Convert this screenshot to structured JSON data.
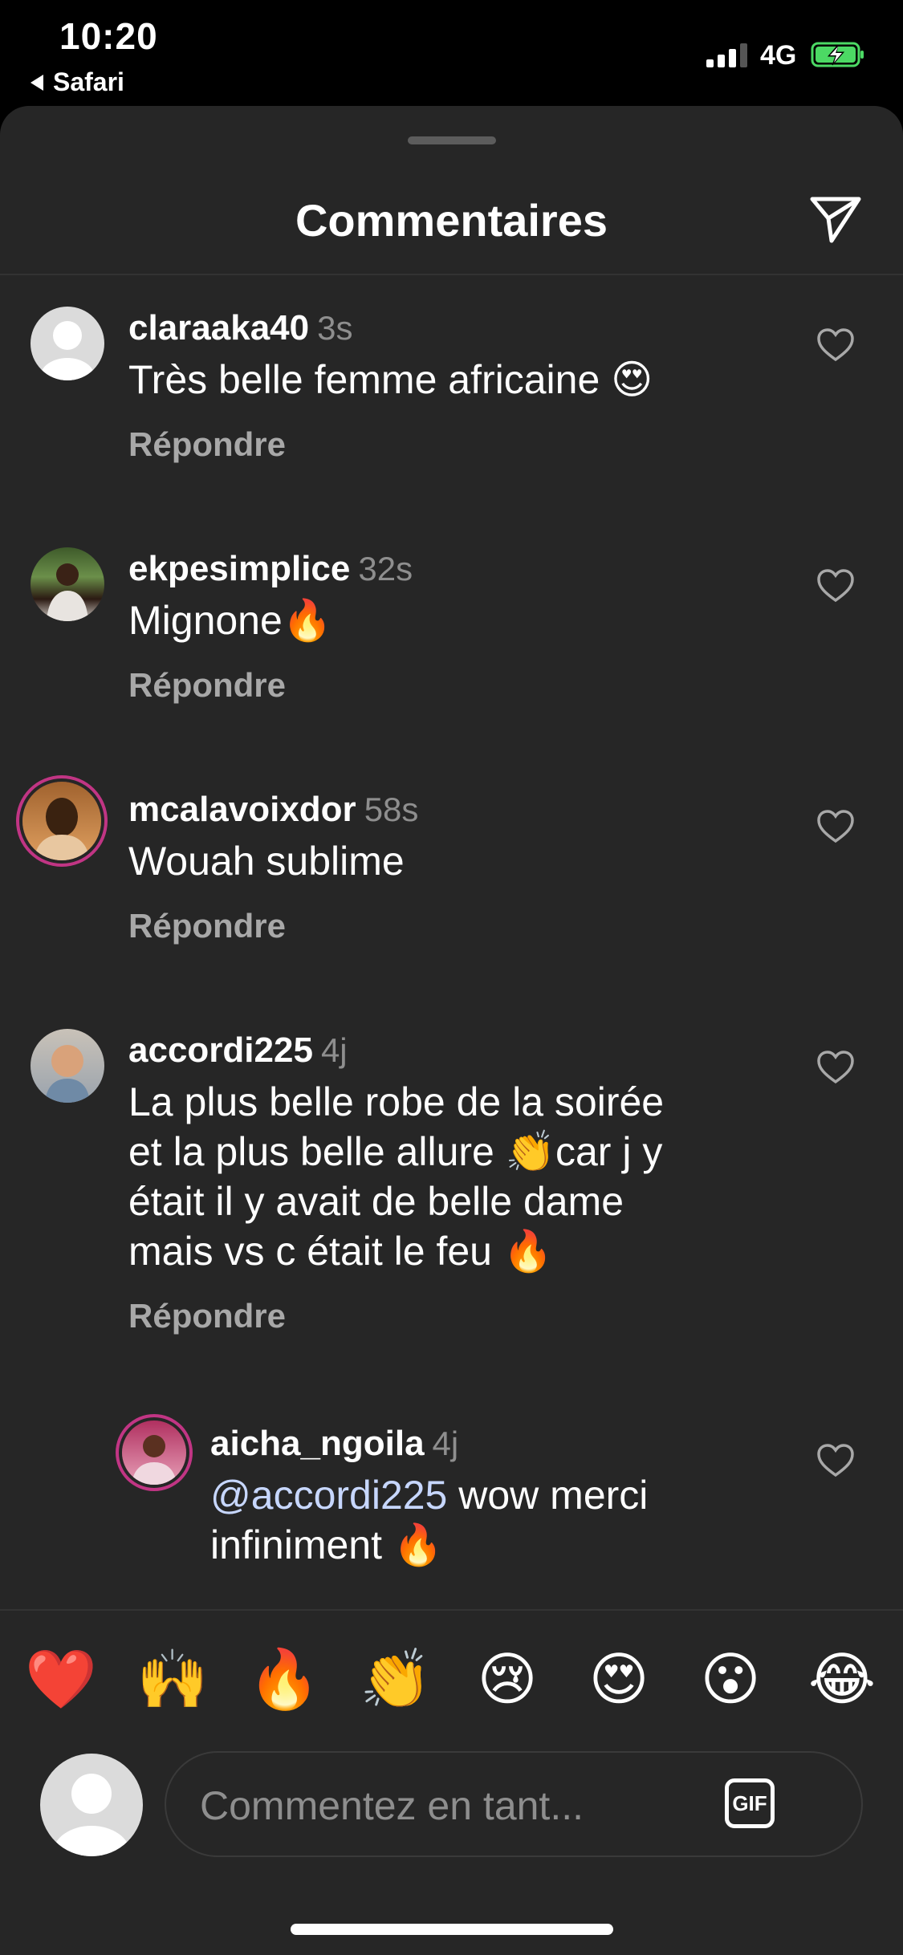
{
  "status_bar": {
    "time": "10:20",
    "back_label": "Safari",
    "network": "4G"
  },
  "sheet": {
    "title": "Commentaires"
  },
  "comments": [
    {
      "username": "claraaka40",
      "time": "3s",
      "text": "Très belle femme africaine 😍",
      "reply_label": "Répondre"
    },
    {
      "username": "ekpesimplice",
      "time": "32s",
      "text": "Mignone🔥",
      "reply_label": "Répondre"
    },
    {
      "username": "mcalavoixdor",
      "time": "58s",
      "text": "Wouah sublime",
      "reply_label": "Répondre"
    },
    {
      "username": "accordi225",
      "time": "4j",
      "text_lines": [
        "La plus belle robe de la soirée",
        "et la plus belle allure 👏car j y",
        "était il y avait de belle dame",
        "mais vs c était le feu 🔥"
      ],
      "reply_label": "Répondre"
    },
    {
      "username": "aicha_ngoila",
      "time": "4j",
      "mention": "@accordi225",
      "text_after_mention": " wow merci",
      "text_line2": "infiniment 🔥"
    }
  ],
  "emoji_bar": [
    "❤️",
    "🙌",
    "🔥",
    "👏",
    "😢",
    "😍",
    "😮",
    "😂"
  ],
  "comment_input": {
    "placeholder": "Commentez en tant...",
    "gif_label": "GIF"
  },
  "colors": {
    "sheet_bg": "#262626",
    "muted_text": "#8e8e8e",
    "mention": "#c7d7ff"
  }
}
